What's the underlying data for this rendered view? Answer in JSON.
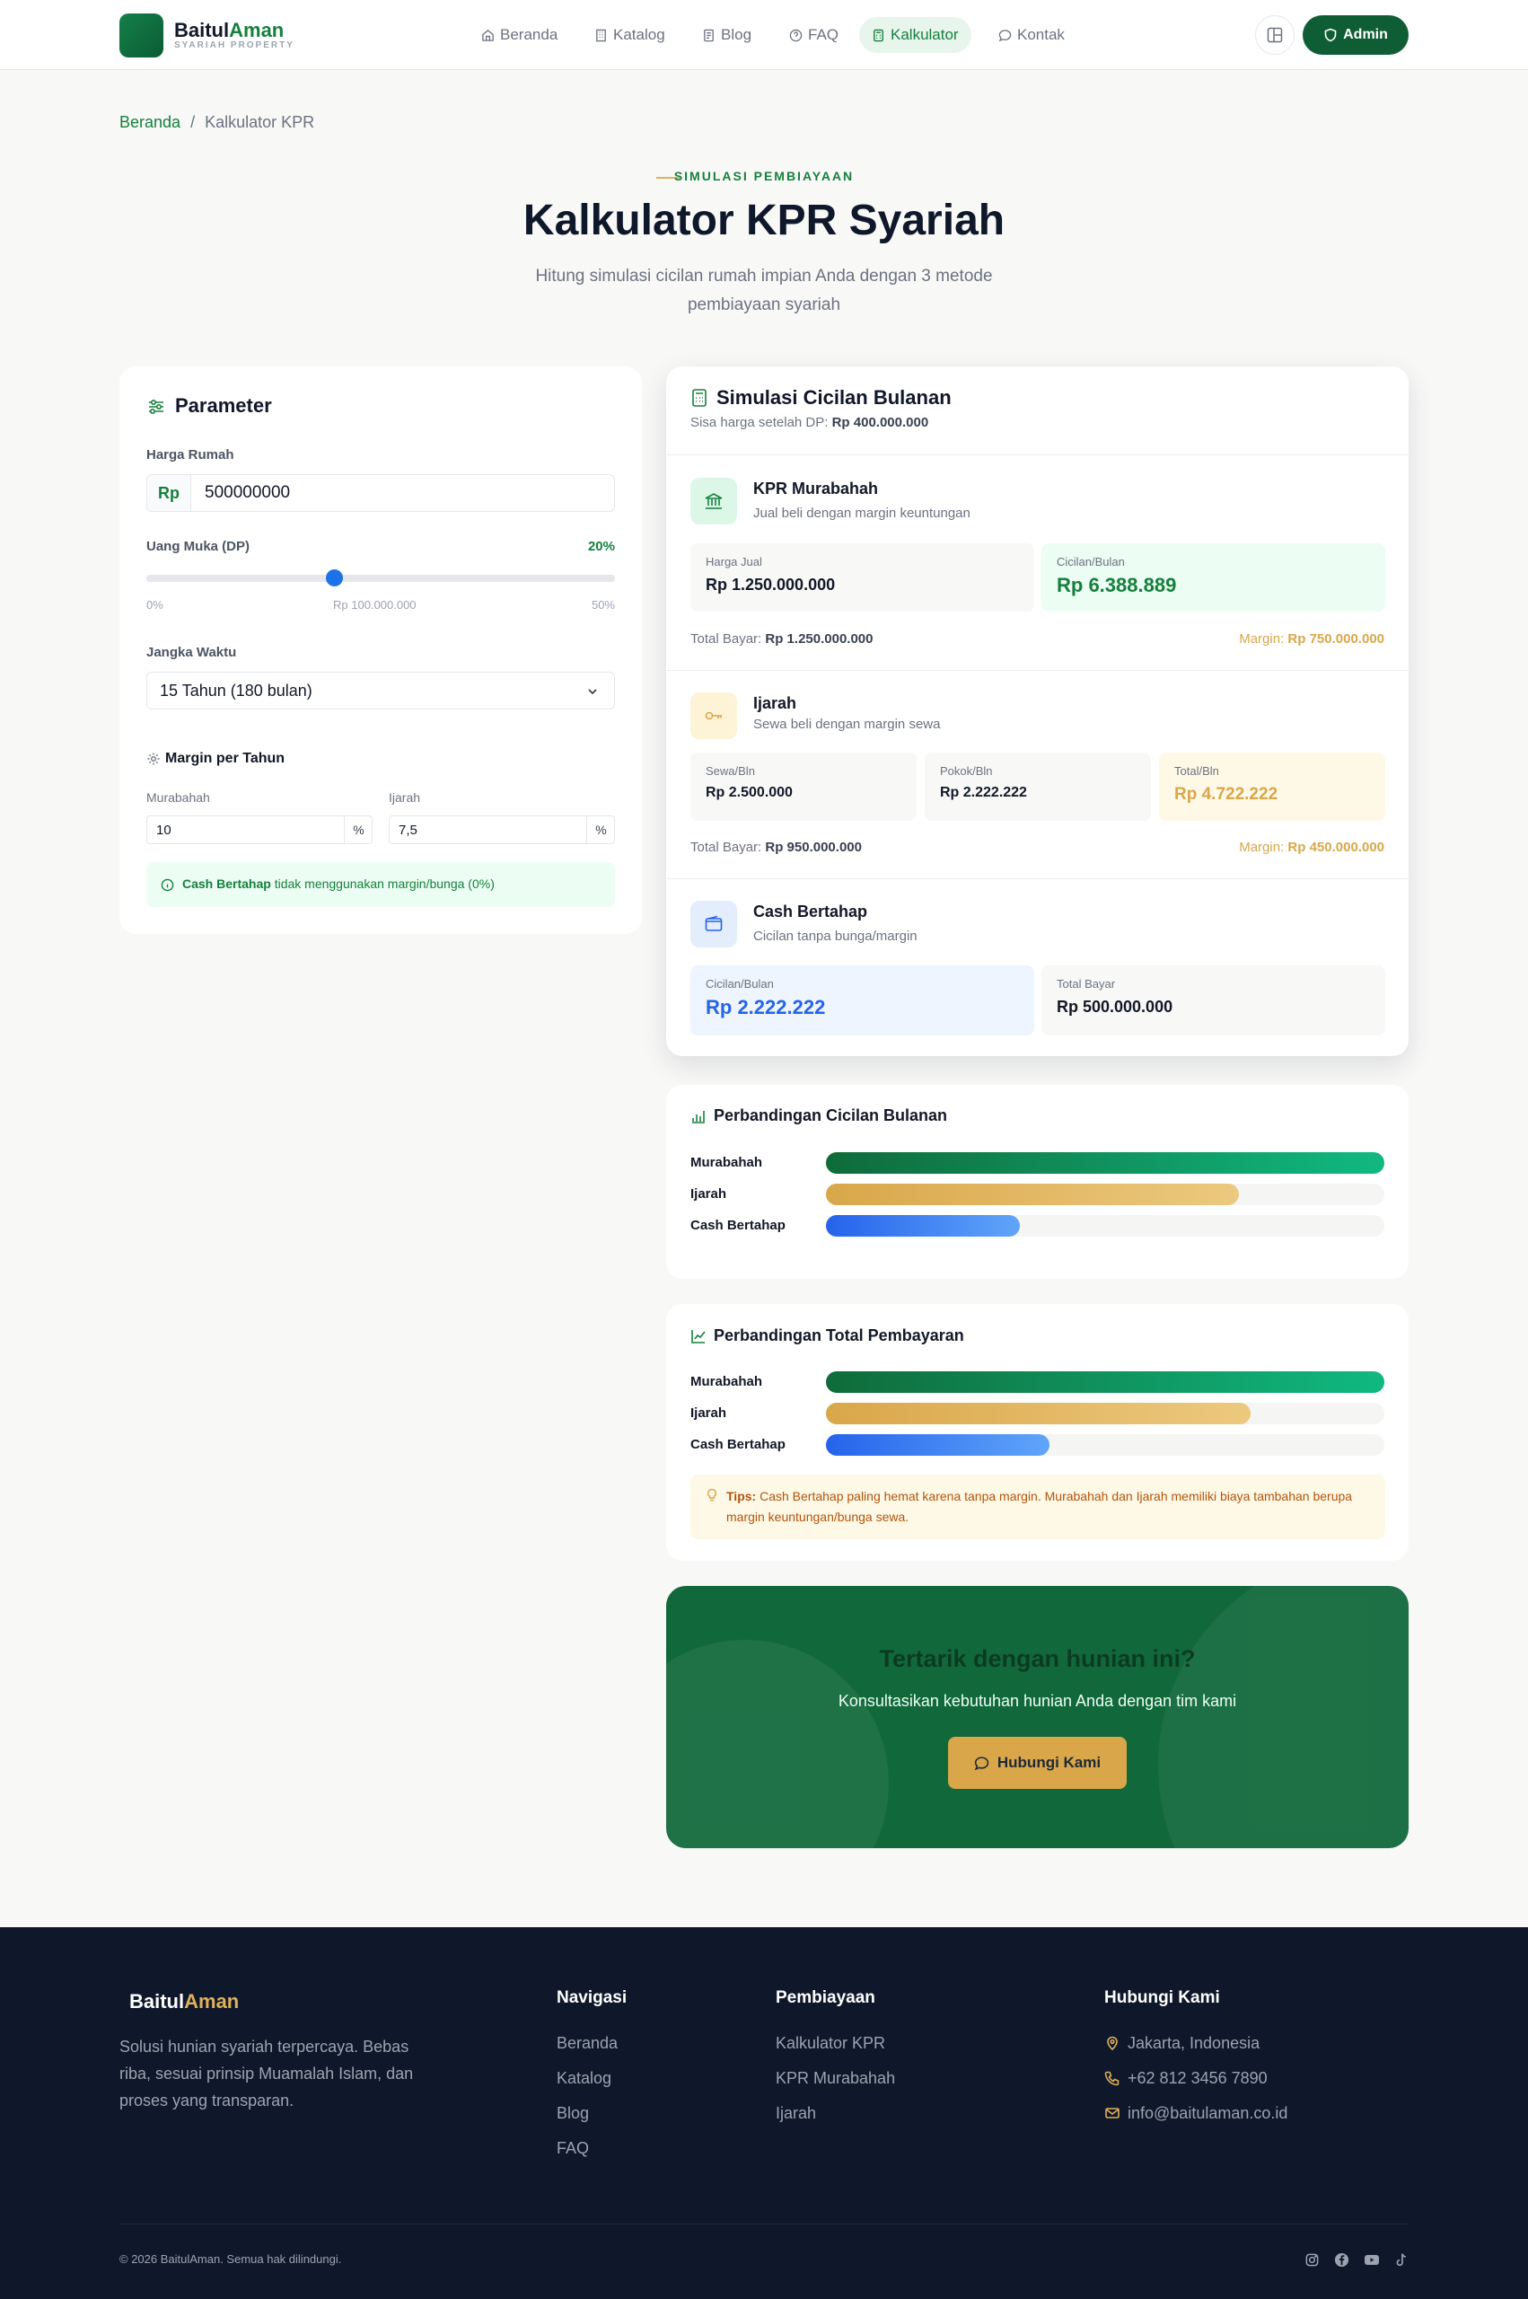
{
  "brand": {
    "name_part1": "Baitul",
    "name_part2": "Aman",
    "tagline": "SYARIAH PROPERTY"
  },
  "nav": [
    {
      "label": "Beranda",
      "icon": "home-icon"
    },
    {
      "label": "Katalog",
      "icon": "building-icon"
    },
    {
      "label": "Blog",
      "icon": "document-icon"
    },
    {
      "label": "FAQ",
      "icon": "help-circle-icon"
    },
    {
      "label": "Kalkulator",
      "icon": "calculator-icon",
      "active": true
    },
    {
      "label": "Kontak",
      "icon": "chat-icon"
    }
  ],
  "admin_label": "Admin",
  "breadcrumb": {
    "home": "Beranda",
    "separator": "/",
    "current": "Kalkulator KPR"
  },
  "hero": {
    "eyebrow": "SIMULASI PEMBIAYAAN",
    "title": "Kalkulator KPR Syariah",
    "subtitle": "Hitung simulasi cicilan rumah impian Anda dengan 3 metode pembiayaan syariah"
  },
  "params": {
    "title": "Parameter",
    "price_label": "Harga Rumah",
    "currency_prefix": "Rp",
    "price_value": "500000000",
    "dp_label": "Uang Muka (DP)",
    "dp_percent": "20%",
    "dp_fraction": 0.4,
    "dp_min": "0%",
    "dp_amount": "Rp 100.000.000",
    "dp_max": "50%",
    "tenor_label": "Jangka Waktu",
    "tenor_value": "15 Tahun (180 bulan)",
    "margin_title": "Margin per Tahun",
    "murabahah_label": "Murabahah",
    "murabahah_value": "10",
    "ijarah_label": "Ijarah",
    "ijarah_value": "7,5",
    "percent_unit": "%",
    "note_bold": "Cash Bertahap",
    "note_rest": "tidak menggunakan margin/bunga (0%)"
  },
  "simulation": {
    "title": "Simulasi Cicilan Bulanan",
    "subtitle_prefix": "Sisa harga setelah DP:",
    "subtitle_value": "Rp 400.000.000",
    "murabahah": {
      "name": "KPR Murabahah",
      "desc": "Jual beli dengan margin keuntungan",
      "box1_label": "Harga Jual",
      "box1_value": "Rp 1.250.000.000",
      "box2_label": "Cicilan/Bulan",
      "box2_value": "Rp 6.388.889",
      "total_label": "Total Bayar:",
      "total_value": "Rp 1.250.000.000",
      "margin_label": "Margin:",
      "margin_value": "Rp 750.000.000"
    },
    "ijarah": {
      "name": "Ijarah",
      "desc": "Sewa beli dengan margin sewa",
      "box1_label": "Sewa/Bln",
      "box1_value": "Rp 2.500.000",
      "box2_label": "Pokok/Bln",
      "box2_value": "Rp 2.222.222",
      "box3_label": "Total/Bln",
      "box3_value": "Rp 4.722.222",
      "total_label": "Total Bayar:",
      "total_value": "Rp 950.000.000",
      "margin_label": "Margin:",
      "margin_value": "Rp 450.000.000"
    },
    "cash": {
      "name": "Cash Bertahap",
      "desc": "Cicilan tanpa bunga/margin",
      "box1_label": "Cicilan/Bulan",
      "box1_value": "Rp 2.222.222",
      "box2_label": "Total Bayar",
      "box2_value": "Rp 500.000.000"
    }
  },
  "compare_monthly": {
    "title": "Perbandingan Cicilan Bulanan",
    "rows": [
      {
        "label": "Murabahah",
        "fraction": 1.0
      },
      {
        "label": "Ijarah",
        "fraction": 0.739
      },
      {
        "label": "Cash Bertahap",
        "fraction": 0.348
      }
    ]
  },
  "compare_total": {
    "title": "Perbandingan Total Pembayaran",
    "rows": [
      {
        "label": "Murabahah",
        "fraction": 1.0
      },
      {
        "label": "Ijarah",
        "fraction": 0.76
      },
      {
        "label": "Cash Bertahap",
        "fraction": 0.4
      }
    ],
    "tip_bold": "Tips:",
    "tip_text": "Cash Bertahap paling hemat karena tanpa margin. Murabahah dan Ijarah memiliki biaya tambahan berupa margin keuntungan/bunga sewa."
  },
  "cta": {
    "title": "Tertarik dengan hunian ini?",
    "subtitle": "Konsultasikan kebutuhan hunian Anda dengan tim kami",
    "button": "Hubungi Kami"
  },
  "footer": {
    "brand1": "Baitul",
    "brand2": "Aman",
    "desc": "Solusi hunian syariah terpercaya. Bebas riba, sesuai prinsip Muamalah Islam, dan proses yang transparan.",
    "nav_title": "Navigasi",
    "nav_links": [
      "Beranda",
      "Katalog",
      "Blog",
      "FAQ"
    ],
    "fin_title": "Pembiayaan",
    "fin_links": [
      "Kalkulator KPR",
      "KPR Murabahah",
      "Ijarah"
    ],
    "contact_title": "Hubungi Kami",
    "location": "Jakarta, Indonesia",
    "phone": "+62 812 3456 7890",
    "email": "info@baitulaman.co.id",
    "copyright": "© 2026 BaitulAman. Semua hak dilindungi."
  },
  "colors": {
    "primary": "#15803d",
    "gold": "#d9a74a",
    "blue": "#2563eb",
    "dark": "#0f172a"
  }
}
